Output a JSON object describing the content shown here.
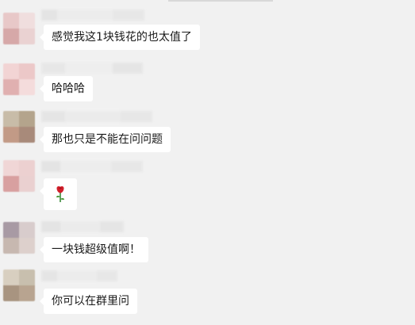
{
  "messages": [
    {
      "text": "感觉我这1块钱花的也太值了",
      "avatar_colors": [
        "#e8c8c8",
        "#f0dede",
        "#d6a8a8",
        "#ead2d2"
      ],
      "name_colors": [
        "#e2e2e2",
        "#ececec",
        "#e6e6e6"
      ]
    },
    {
      "text": "哈哈哈",
      "avatar_colors": [
        "#f2d4d4",
        "#ecc8c8",
        "#e0b0b0",
        "#f4dcdc"
      ],
      "name_colors": [
        "#e6e6e6",
        "#eeeeee",
        "#e4e4e4"
      ]
    },
    {
      "text": "那也只是不能在问问题",
      "avatar_colors": [
        "#c8bca8",
        "#b4a48c",
        "#c29a86",
        "#a88a7a"
      ],
      "name_colors": [
        "#e4e4e4",
        "#ebebeb",
        "#e6e6e6"
      ]
    },
    {
      "text": "🌹",
      "avatar_colors": [
        "#f0d6d6",
        "#ecd0d0",
        "#d8a0a0",
        "#ead0d0"
      ],
      "name_colors": [
        "#e2e2e2",
        "#ededed",
        "#e6e6e6"
      ]
    },
    {
      "text": "一块钱超级值啊！",
      "avatar_colors": [
        "#a89aa4",
        "#d8cccc",
        "#c7b8b0",
        "#ddd0cc"
      ],
      "name_colors": [
        "#e2e2e2",
        "#ebebeb",
        "#e4e4e4"
      ]
    },
    {
      "text": "你可以在群里问",
      "avatar_colors": [
        "#d8cfc0",
        "#c8bfae",
        "#a89480",
        "#b8a490"
      ],
      "name_colors": [
        "#e4e4e4",
        "#ececec",
        "#e6e6e6"
      ]
    }
  ],
  "icons": {
    "rose": "rose-emoji-icon"
  },
  "colors": {
    "background": "#f1f1f1",
    "bubble": "#ffffff",
    "text": "#1a1a1a"
  }
}
